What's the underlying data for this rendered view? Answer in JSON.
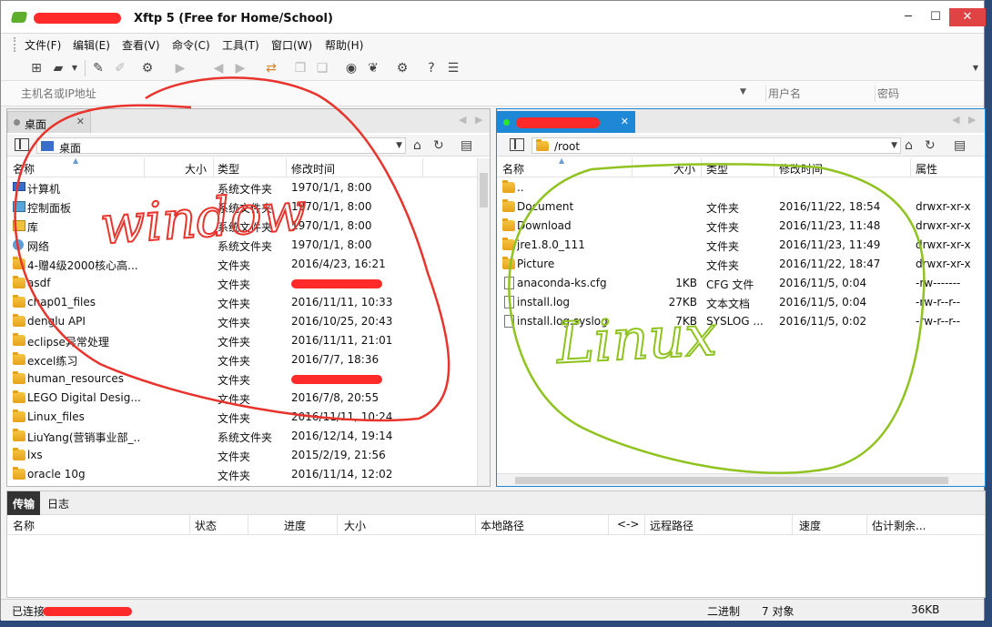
{
  "window": {
    "title": "Xftp 5 (Free for Home/School)",
    "minimize": "─",
    "maximize": "☐",
    "close": "✕"
  },
  "menu": [
    "文件(F)",
    "编辑(E)",
    "查看(V)",
    "命令(C)",
    "工具(T)",
    "窗口(W)",
    "帮助(H)"
  ],
  "address": {
    "host_placeholder": "主机名或IP地址",
    "user_placeholder": "用户名",
    "pass_placeholder": "密码"
  },
  "left_pane": {
    "tab_label": "桌面",
    "path": "桌面",
    "columns": [
      "名称",
      "大小",
      "类型",
      "修改时间"
    ],
    "rows": [
      {
        "icon": "pc",
        "name": "计算机",
        "size": "",
        "type": "系统文件夹",
        "modified": "1970/1/1, 8:00"
      },
      {
        "icon": "panel",
        "name": "控制面板",
        "size": "",
        "type": "系统文件夹",
        "modified": "1970/1/1, 8:00"
      },
      {
        "icon": "lib",
        "name": "库",
        "size": "",
        "type": "系统文件夹",
        "modified": "1970/1/1, 8:00"
      },
      {
        "icon": "net",
        "name": "网络",
        "size": "",
        "type": "系统文件夹",
        "modified": "1970/1/1, 8:00"
      },
      {
        "icon": "folder",
        "name": "4-赠4级2000核心高...",
        "size": "",
        "type": "文件夹",
        "modified": "2016/4/23, 16:21"
      },
      {
        "icon": "folder",
        "name": "asdf",
        "size": "",
        "type": "文件夹",
        "modified": ""
      },
      {
        "icon": "folder",
        "name": "chap01_files",
        "size": "",
        "type": "文件夹",
        "modified": "2016/11/11, 10:33"
      },
      {
        "icon": "folder",
        "name": "denglu API",
        "size": "",
        "type": "文件夹",
        "modified": "2016/10/25, 20:43"
      },
      {
        "icon": "folder",
        "name": "eclipse异常处理",
        "size": "",
        "type": "文件夹",
        "modified": "2016/11/11, 21:01"
      },
      {
        "icon": "folder",
        "name": "excel练习",
        "size": "",
        "type": "文件夹",
        "modified": "2016/7/7, 18:36"
      },
      {
        "icon": "folder",
        "name": "human_resources",
        "size": "",
        "type": "文件夹",
        "modified": ""
      },
      {
        "icon": "folder",
        "name": "LEGO Digital Desig...",
        "size": "",
        "type": "文件夹",
        "modified": "2016/7/8, 20:55"
      },
      {
        "icon": "folder",
        "name": "Linux_files",
        "size": "",
        "type": "文件夹",
        "modified": "2016/11/11, 10:24"
      },
      {
        "icon": "folder",
        "name": "LiuYang(营销事业部_...",
        "size": "",
        "type": "系统文件夹",
        "modified": "2016/12/14, 19:14"
      },
      {
        "icon": "folder",
        "name": "lxs",
        "size": "",
        "type": "文件夹",
        "modified": "2015/2/19, 21:56"
      },
      {
        "icon": "folder",
        "name": "oracle 10g",
        "size": "",
        "type": "文件夹",
        "modified": "2016/11/14, 12:02"
      }
    ]
  },
  "right_pane": {
    "path": "/root",
    "columns": [
      "名称",
      "大小",
      "类型",
      "修改时间",
      "属性"
    ],
    "rows": [
      {
        "icon": "folder",
        "name": "..",
        "size": "",
        "type": "",
        "modified": "",
        "attr": ""
      },
      {
        "icon": "folder",
        "name": "Document",
        "size": "",
        "type": "文件夹",
        "modified": "2016/11/22, 18:54",
        "attr": "drwxr-xr-x"
      },
      {
        "icon": "folder",
        "name": "Download",
        "size": "",
        "type": "文件夹",
        "modified": "2016/11/23, 11:48",
        "attr": "drwxr-xr-x"
      },
      {
        "icon": "folder",
        "name": "jre1.8.0_111",
        "size": "",
        "type": "文件夹",
        "modified": "2016/11/23, 11:49",
        "attr": "drwxr-xr-x"
      },
      {
        "icon": "folder",
        "name": "Picture",
        "size": "",
        "type": "文件夹",
        "modified": "2016/11/22, 18:47",
        "attr": "drwxr-xr-x"
      },
      {
        "icon": "file",
        "name": "anaconda-ks.cfg",
        "size": "1KB",
        "type": "CFG 文件",
        "modified": "2016/11/5, 0:04",
        "attr": "-rw-------"
      },
      {
        "icon": "file",
        "name": "install.log",
        "size": "27KB",
        "type": "文本文档",
        "modified": "2016/11/5, 0:04",
        "attr": "-rw-r--r--"
      },
      {
        "icon": "file",
        "name": "install.log.syslog",
        "size": "7KB",
        "type": "SYSLOG ...",
        "modified": "2016/11/5, 0:02",
        "attr": "-rw-r--r--"
      }
    ]
  },
  "transfer": {
    "tabs": [
      "传输",
      "日志"
    ],
    "columns": [
      "名称",
      "状态",
      "进度",
      "大小",
      "本地路径",
      "<->",
      "远程路径",
      "速度",
      "估计剩余..."
    ]
  },
  "status": {
    "connection": "已连接",
    "mode": "二进制",
    "objects": "7 对象",
    "size": "36KB"
  },
  "annotations": {
    "left": "window",
    "right": "Linux"
  },
  "colors": {
    "accent": "#1e88d6",
    "redaction": "#ff2a2a",
    "left_scribble": "#e8342c",
    "right_scribble": "#8fc31f"
  }
}
